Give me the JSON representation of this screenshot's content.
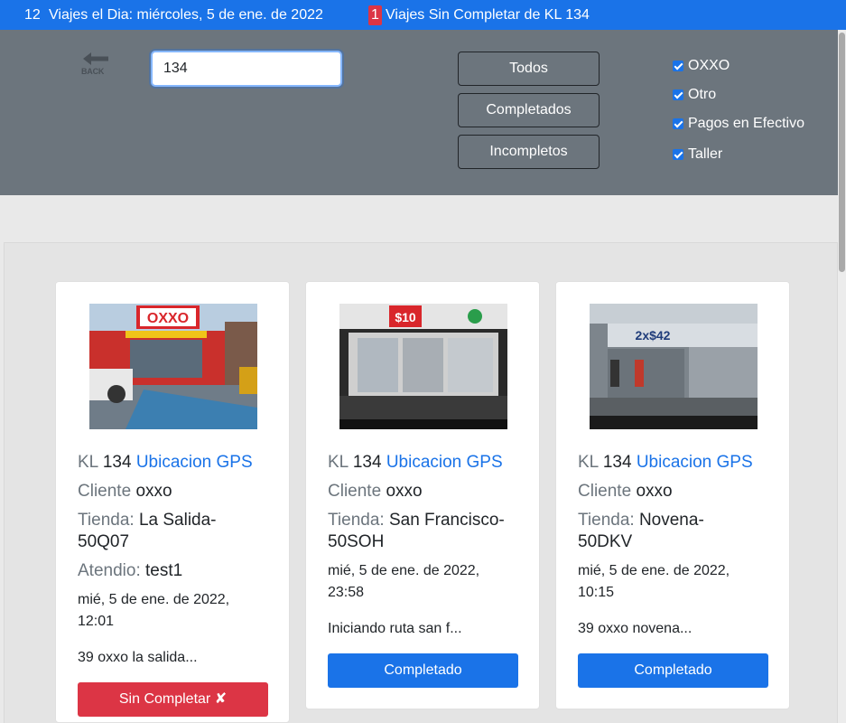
{
  "topbar": {
    "trips_count": "12",
    "trips_label": "Viajes el Dia: miércoles, 5 de ene. de 2022",
    "incomplete_count": "1",
    "incomplete_label": "Viajes Sin Completar de KL 134"
  },
  "filters": {
    "back_label": "BACK",
    "search_value": "134",
    "buttons": {
      "all": "Todos",
      "completed": "Completados",
      "incomplete": "Incompletos"
    },
    "checkboxes": [
      {
        "label": "OXXO",
        "checked": true
      },
      {
        "label": "Otro",
        "checked": true
      },
      {
        "label": "Pagos en Efectivo",
        "checked": true
      },
      {
        "label": "Taller",
        "checked": true
      }
    ]
  },
  "cards": [
    {
      "unit_prefix": "KL",
      "unit_number": "134",
      "gps_link": "Ubicacion GPS",
      "client_label": "Cliente",
      "client": "oxxo",
      "store_label": "Tienda:",
      "store": "La Salida-50Q07",
      "attended_label": "Atendio:",
      "attended": "test1",
      "date": "mié, 5 de ene. de 2022, 12:01",
      "note": "39 oxxo la salida...",
      "status_button": "Sin Completar ✘",
      "status": "incomplete"
    },
    {
      "unit_prefix": "KL",
      "unit_number": "134",
      "gps_link": "Ubicacion GPS",
      "client_label": "Cliente",
      "client": "oxxo",
      "store_label": "Tienda:",
      "store": "San Francisco-50SOH",
      "date": "mié, 5 de ene. de 2022, 23:58",
      "note": "Iniciando ruta san f...",
      "status_button": "Completado",
      "status": "completed"
    },
    {
      "unit_prefix": "KL",
      "unit_number": "134",
      "gps_link": "Ubicacion GPS",
      "client_label": "Cliente",
      "client": "oxxo",
      "store_label": "Tienda:",
      "store": "Novena-50DKV",
      "date": "mié, 5 de ene. de 2022, 10:15",
      "note": "39 oxxo novena...",
      "status_button": "Completado",
      "status": "completed"
    }
  ],
  "colors": {
    "primary": "#1a73e8",
    "danger": "#dc3545",
    "filter_bg": "#6c757d",
    "page_bg": "#e9e9e9"
  }
}
